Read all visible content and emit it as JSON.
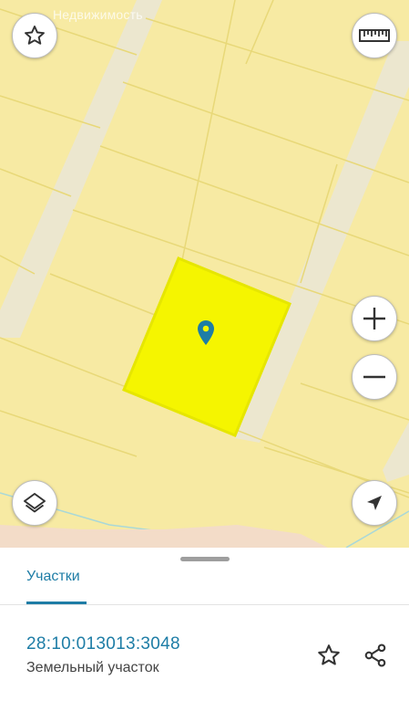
{
  "map": {
    "watermark": "Недвижимость",
    "colors": {
      "land": "#f7eaa3",
      "road": "#ece7cf",
      "parcel_border": "#e8d878",
      "selected_parcel": "#f5f500",
      "selected_border": "#e6e600",
      "marker": "#1e7da6",
      "water_zone": "#f3dcc8"
    },
    "buttons": {
      "favorite_icon": "star-outline-icon",
      "ruler_icon": "ruler-icon",
      "zoom_in_icon": "plus-icon",
      "zoom_out_icon": "minus-icon",
      "layers_icon": "layers-icon",
      "locate_icon": "navigation-arrow-icon"
    }
  },
  "sheet": {
    "tab_label": "Участки",
    "parcel": {
      "cadastral_number": "28:10:013013:3048",
      "type": "Земельный участок"
    },
    "actions": {
      "favorite_icon": "star-outline-icon",
      "share_icon": "share-icon"
    },
    "colors": {
      "accent": "#1e7da6",
      "text_secondary": "#444444"
    }
  }
}
